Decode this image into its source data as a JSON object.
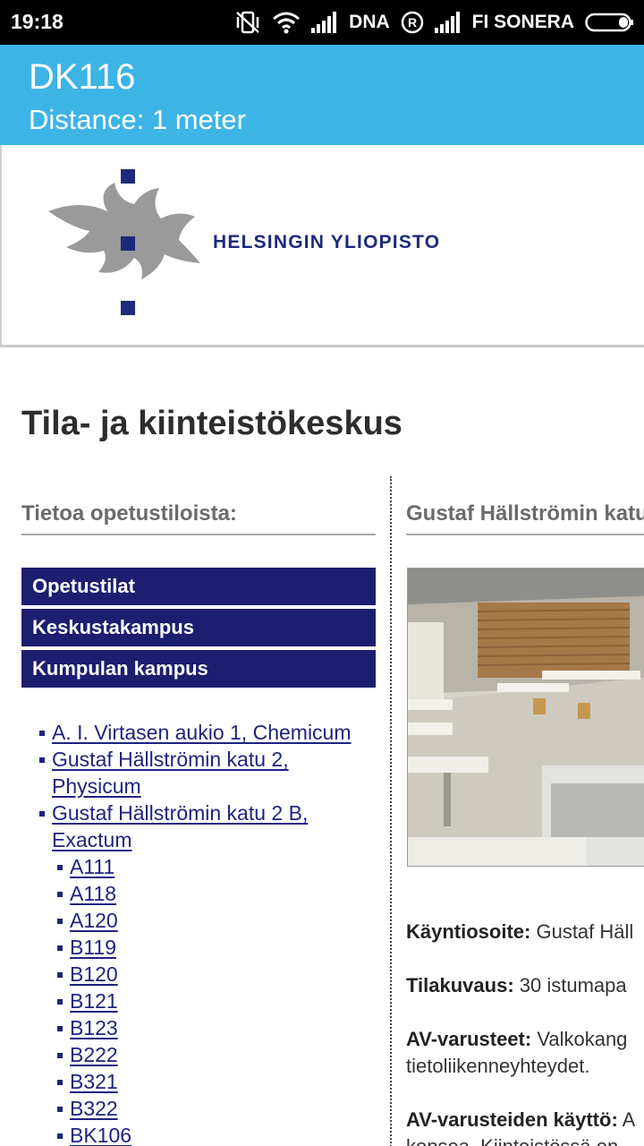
{
  "status_bar": {
    "time": "19:18",
    "carrier1": "DNA",
    "roaming": "R",
    "carrier2": "FI SONERA"
  },
  "app_bar": {
    "title": "DK116",
    "subtitle": "Distance: 1 meter"
  },
  "logo": {
    "text": "HELSINGIN YLIOPISTO"
  },
  "page": {
    "title": "Tila- ja kiinteistökeskus"
  },
  "left": {
    "heading": "Tietoa opetustiloista:",
    "nav": [
      "Opetustilat",
      "Keskustakampus",
      "Kumpulan kampus"
    ],
    "links_level1": [
      {
        "line1": "A. I. Virtasen aukio 1, Chemicum",
        "line2": ""
      },
      {
        "line1": "Gustaf Hällströmin katu 2,",
        "line2": "Physicum"
      },
      {
        "line1": "Gustaf Hällströmin katu 2 B,",
        "line2": "Exactum"
      }
    ],
    "rooms": [
      "A111",
      "A118",
      "A120",
      "B119",
      "B120",
      "B121",
      "B123",
      "B222",
      "B321",
      "B322",
      "BK106"
    ]
  },
  "right": {
    "heading": "Gustaf Hällströmin katu",
    "info": [
      {
        "label": "Käyntiosoite:",
        "value": " Gustaf Häll"
      },
      {
        "label": "Tilakuvaus:",
        "value": " 30 istumapa"
      },
      {
        "label": "AV-varusteet:",
        "value": " Valkokang",
        "line2": "tietoliikenneyhteydet."
      },
      {
        "label": "AV-varusteiden käyttö:",
        "value": " A",
        "line2": "kopsea. Kiinteistössä on"
      }
    ]
  },
  "colors": {
    "app_bar": "#3cb4e5",
    "nav_bg": "#1c1e6f",
    "link": "#1f2380",
    "logo_blue": "#1d2a7c"
  }
}
